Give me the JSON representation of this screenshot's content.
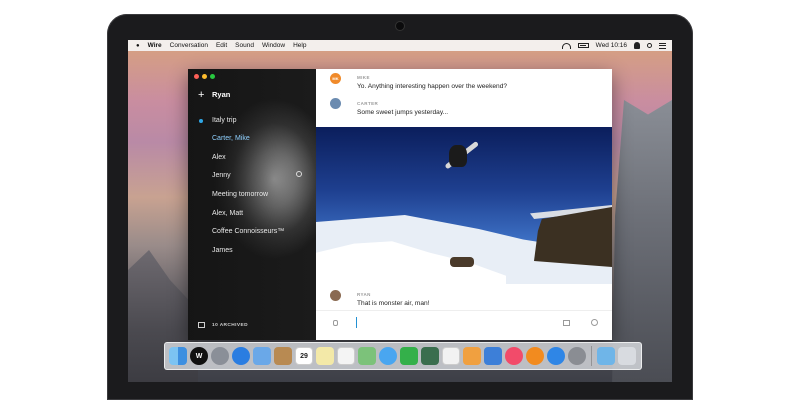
{
  "menubar": {
    "apple": "",
    "app_name": "Wire",
    "menus": [
      "Conversation",
      "Edit",
      "Sound",
      "Window",
      "Help"
    ],
    "clock": "Wed 10:16"
  },
  "sidebar": {
    "user": "Ryan",
    "conversations": [
      {
        "label": "Italy trip",
        "unread": true
      },
      {
        "label": "Carter, Mike",
        "active": true
      },
      {
        "label": "Alex"
      },
      {
        "label": "Jenny",
        "muted": true
      },
      {
        "label": "Meeting tomorrow"
      },
      {
        "label": "Alex, Matt"
      },
      {
        "label": "Coffee Connoisseurs™"
      },
      {
        "label": "James"
      }
    ],
    "archived_label": "10 ARCHIVED"
  },
  "messages": [
    {
      "sender": "MIKE",
      "initials": "MK",
      "text": "Yo. Anything interesting happen over the weekend?",
      "avatar_color": "#f08a2a"
    },
    {
      "sender": "CARTER",
      "text": "Some sweet jumps yesterday...",
      "avatar_color": "#6b8bb0"
    },
    {
      "sender": "RYAN",
      "text": "That is monster air, man!",
      "avatar_color": "#8a6a52"
    }
  ],
  "dock": {
    "apps": [
      "finder-icon",
      "wire-icon",
      "launchpad-icon",
      "safari-icon",
      "mail-icon",
      "contacts-icon",
      "calendar-icon",
      "notes-icon",
      "reminders-icon",
      "maps-icon",
      "messages-icon",
      "facetime-icon",
      "photo-booth-icon",
      "photos-icon",
      "pages-icon",
      "keynote-icon",
      "itunes-icon",
      "ibooks-icon",
      "app-store-icon",
      "system-preferences-icon",
      "folder-icon",
      "trash-icon"
    ],
    "calendar_day": "29"
  }
}
